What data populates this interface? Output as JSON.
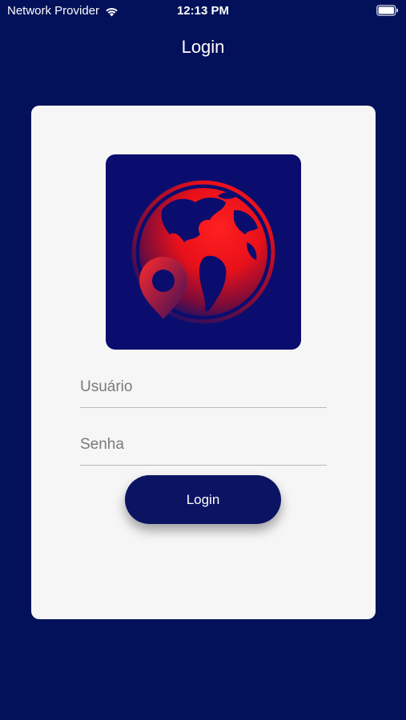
{
  "status_bar": {
    "carrier": "Network Provider",
    "time": "12:13 PM",
    "wifi_icon": "wifi-icon",
    "battery_icon": "battery-icon"
  },
  "nav": {
    "title": "Login"
  },
  "login_form": {
    "logo_icon": "globe-location-pin-icon",
    "username": {
      "placeholder": "Usuário",
      "value": ""
    },
    "password": {
      "placeholder": "Senha",
      "value": ""
    },
    "submit_label": "Login"
  },
  "colors": {
    "background": "#021159",
    "card": "#f6f6f6",
    "button": "#0b1463",
    "logo_red": "#ff1a1a"
  }
}
